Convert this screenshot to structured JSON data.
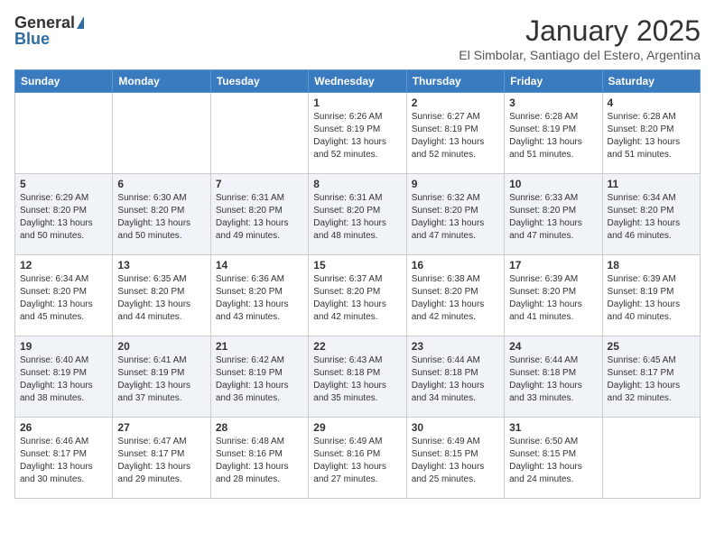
{
  "logo": {
    "general": "General",
    "blue": "Blue"
  },
  "title": "January 2025",
  "location": "El Simbolar, Santiago del Estero, Argentina",
  "days_of_week": [
    "Sunday",
    "Monday",
    "Tuesday",
    "Wednesday",
    "Thursday",
    "Friday",
    "Saturday"
  ],
  "weeks": [
    [
      {
        "day": "",
        "sunrise": "",
        "sunset": "",
        "daylight": ""
      },
      {
        "day": "",
        "sunrise": "",
        "sunset": "",
        "daylight": ""
      },
      {
        "day": "",
        "sunrise": "",
        "sunset": "",
        "daylight": ""
      },
      {
        "day": "1",
        "sunrise": "Sunrise: 6:26 AM",
        "sunset": "Sunset: 8:19 PM",
        "daylight": "Daylight: 13 hours and 52 minutes."
      },
      {
        "day": "2",
        "sunrise": "Sunrise: 6:27 AM",
        "sunset": "Sunset: 8:19 PM",
        "daylight": "Daylight: 13 hours and 52 minutes."
      },
      {
        "day": "3",
        "sunrise": "Sunrise: 6:28 AM",
        "sunset": "Sunset: 8:19 PM",
        "daylight": "Daylight: 13 hours and 51 minutes."
      },
      {
        "day": "4",
        "sunrise": "Sunrise: 6:28 AM",
        "sunset": "Sunset: 8:20 PM",
        "daylight": "Daylight: 13 hours and 51 minutes."
      }
    ],
    [
      {
        "day": "5",
        "sunrise": "Sunrise: 6:29 AM",
        "sunset": "Sunset: 8:20 PM",
        "daylight": "Daylight: 13 hours and 50 minutes."
      },
      {
        "day": "6",
        "sunrise": "Sunrise: 6:30 AM",
        "sunset": "Sunset: 8:20 PM",
        "daylight": "Daylight: 13 hours and 50 minutes."
      },
      {
        "day": "7",
        "sunrise": "Sunrise: 6:31 AM",
        "sunset": "Sunset: 8:20 PM",
        "daylight": "Daylight: 13 hours and 49 minutes."
      },
      {
        "day": "8",
        "sunrise": "Sunrise: 6:31 AM",
        "sunset": "Sunset: 8:20 PM",
        "daylight": "Daylight: 13 hours and 48 minutes."
      },
      {
        "day": "9",
        "sunrise": "Sunrise: 6:32 AM",
        "sunset": "Sunset: 8:20 PM",
        "daylight": "Daylight: 13 hours and 47 minutes."
      },
      {
        "day": "10",
        "sunrise": "Sunrise: 6:33 AM",
        "sunset": "Sunset: 8:20 PM",
        "daylight": "Daylight: 13 hours and 47 minutes."
      },
      {
        "day": "11",
        "sunrise": "Sunrise: 6:34 AM",
        "sunset": "Sunset: 8:20 PM",
        "daylight": "Daylight: 13 hours and 46 minutes."
      }
    ],
    [
      {
        "day": "12",
        "sunrise": "Sunrise: 6:34 AM",
        "sunset": "Sunset: 8:20 PM",
        "daylight": "Daylight: 13 hours and 45 minutes."
      },
      {
        "day": "13",
        "sunrise": "Sunrise: 6:35 AM",
        "sunset": "Sunset: 8:20 PM",
        "daylight": "Daylight: 13 hours and 44 minutes."
      },
      {
        "day": "14",
        "sunrise": "Sunrise: 6:36 AM",
        "sunset": "Sunset: 8:20 PM",
        "daylight": "Daylight: 13 hours and 43 minutes."
      },
      {
        "day": "15",
        "sunrise": "Sunrise: 6:37 AM",
        "sunset": "Sunset: 8:20 PM",
        "daylight": "Daylight: 13 hours and 42 minutes."
      },
      {
        "day": "16",
        "sunrise": "Sunrise: 6:38 AM",
        "sunset": "Sunset: 8:20 PM",
        "daylight": "Daylight: 13 hours and 42 minutes."
      },
      {
        "day": "17",
        "sunrise": "Sunrise: 6:39 AM",
        "sunset": "Sunset: 8:20 PM",
        "daylight": "Daylight: 13 hours and 41 minutes."
      },
      {
        "day": "18",
        "sunrise": "Sunrise: 6:39 AM",
        "sunset": "Sunset: 8:19 PM",
        "daylight": "Daylight: 13 hours and 40 minutes."
      }
    ],
    [
      {
        "day": "19",
        "sunrise": "Sunrise: 6:40 AM",
        "sunset": "Sunset: 8:19 PM",
        "daylight": "Daylight: 13 hours and 38 minutes."
      },
      {
        "day": "20",
        "sunrise": "Sunrise: 6:41 AM",
        "sunset": "Sunset: 8:19 PM",
        "daylight": "Daylight: 13 hours and 37 minutes."
      },
      {
        "day": "21",
        "sunrise": "Sunrise: 6:42 AM",
        "sunset": "Sunset: 8:19 PM",
        "daylight": "Daylight: 13 hours and 36 minutes."
      },
      {
        "day": "22",
        "sunrise": "Sunrise: 6:43 AM",
        "sunset": "Sunset: 8:18 PM",
        "daylight": "Daylight: 13 hours and 35 minutes."
      },
      {
        "day": "23",
        "sunrise": "Sunrise: 6:44 AM",
        "sunset": "Sunset: 8:18 PM",
        "daylight": "Daylight: 13 hours and 34 minutes."
      },
      {
        "day": "24",
        "sunrise": "Sunrise: 6:44 AM",
        "sunset": "Sunset: 8:18 PM",
        "daylight": "Daylight: 13 hours and 33 minutes."
      },
      {
        "day": "25",
        "sunrise": "Sunrise: 6:45 AM",
        "sunset": "Sunset: 8:17 PM",
        "daylight": "Daylight: 13 hours and 32 minutes."
      }
    ],
    [
      {
        "day": "26",
        "sunrise": "Sunrise: 6:46 AM",
        "sunset": "Sunset: 8:17 PM",
        "daylight": "Daylight: 13 hours and 30 minutes."
      },
      {
        "day": "27",
        "sunrise": "Sunrise: 6:47 AM",
        "sunset": "Sunset: 8:17 PM",
        "daylight": "Daylight: 13 hours and 29 minutes."
      },
      {
        "day": "28",
        "sunrise": "Sunrise: 6:48 AM",
        "sunset": "Sunset: 8:16 PM",
        "daylight": "Daylight: 13 hours and 28 minutes."
      },
      {
        "day": "29",
        "sunrise": "Sunrise: 6:49 AM",
        "sunset": "Sunset: 8:16 PM",
        "daylight": "Daylight: 13 hours and 27 minutes."
      },
      {
        "day": "30",
        "sunrise": "Sunrise: 6:49 AM",
        "sunset": "Sunset: 8:15 PM",
        "daylight": "Daylight: 13 hours and 25 minutes."
      },
      {
        "day": "31",
        "sunrise": "Sunrise: 6:50 AM",
        "sunset": "Sunset: 8:15 PM",
        "daylight": "Daylight: 13 hours and 24 minutes."
      },
      {
        "day": "",
        "sunrise": "",
        "sunset": "",
        "daylight": ""
      }
    ]
  ]
}
